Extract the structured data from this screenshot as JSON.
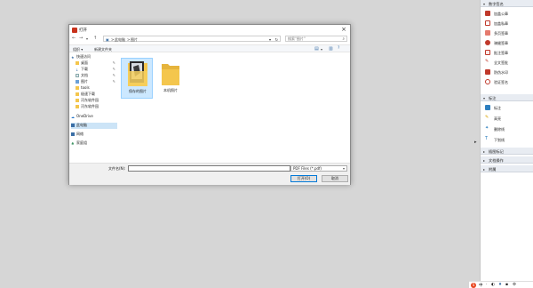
{
  "dialog": {
    "title": "打开",
    "nav": {
      "back": "←",
      "forward": "→",
      "up": "↑"
    },
    "address": {
      "crumbs": [
        "此电脑",
        "图片"
      ],
      "sep": ">"
    },
    "search": {
      "placeholder": "搜索\"图片\""
    },
    "toolbar": {
      "organize": "组织 ▾",
      "new_folder": "新建文件夹"
    },
    "nav_pane": [
      {
        "label": "快速访问",
        "icon": "star-icon",
        "pinned": false
      },
      {
        "label": "桌面",
        "icon": "desktop-icon",
        "pinned": true
      },
      {
        "label": "下载",
        "icon": "download-icon",
        "pinned": true
      },
      {
        "label": "文档",
        "icon": "document-icon",
        "pinned": true
      },
      {
        "label": "图片",
        "icon": "pictures-icon",
        "pinned": true
      },
      {
        "label": "tools",
        "icon": "folder-icon",
        "pinned": false
      },
      {
        "label": "极速下载",
        "icon": "folder-icon",
        "pinned": false
      },
      {
        "label": "河东软件园",
        "icon": "folder-icon",
        "pinned": false
      },
      {
        "label": "河东软件园",
        "icon": "folder-icon",
        "pinned": false
      },
      {
        "label": "OneDrive",
        "icon": "cloud-icon",
        "pinned": false
      },
      {
        "label": "此电脑",
        "icon": "computer-icon",
        "pinned": false,
        "selected": true
      },
      {
        "label": "网络",
        "icon": "network-icon",
        "pinned": false
      },
      {
        "label": "家庭组",
        "icon": "homegroup-icon",
        "pinned": false
      }
    ],
    "files": [
      {
        "label": "保存的图片",
        "selected": true
      },
      {
        "label": "本机照片",
        "selected": false
      }
    ],
    "filename_label": "文件名(N):",
    "filename_value": "",
    "filter": "PDF Files (*.pdf)",
    "open_button": "打开(O)",
    "cancel_button": "取消"
  },
  "rightpanel": {
    "sections": [
      {
        "title": "数字签名",
        "expanded": true,
        "tools": [
          {
            "label": "加盖公章",
            "icon": "stamp-icon",
            "color": "#c0392b"
          },
          {
            "label": "加盖私章",
            "icon": "seal-icon",
            "color": "#c0392b"
          },
          {
            "label": "多页签章",
            "icon": "multi-stamp-icon",
            "color": "#c0392b"
          },
          {
            "label": "骑缝签章",
            "icon": "seam-stamp-icon",
            "color": "#c0392b"
          },
          {
            "label": "批注签章",
            "icon": "annotation-stamp-icon",
            "color": "#c0392b"
          },
          {
            "label": "全文签批",
            "icon": "pen-sign-icon",
            "color": "#c0392b"
          },
          {
            "label": "防伪水印",
            "icon": "watermark-icon",
            "color": "#c0392b"
          },
          {
            "label": "验证签名",
            "icon": "verify-icon",
            "color": "#c0392b"
          }
        ]
      },
      {
        "title": "标注",
        "expanded": true,
        "tools": [
          {
            "label": "标注",
            "icon": "comment-icon",
            "color": "#2e7fbf"
          },
          {
            "label": "高亮",
            "icon": "highlight-icon",
            "color": "#d9a400"
          },
          {
            "label": "删除线",
            "icon": "strikethrough-icon",
            "color": "#2e7fbf"
          },
          {
            "label": "下划线",
            "icon": "underline-icon",
            "color": "#2e7fbf"
          }
        ]
      },
      {
        "title": "插图标记",
        "expanded": false,
        "tools": []
      },
      {
        "title": "文档操作",
        "expanded": false,
        "tools": []
      },
      {
        "title": "附属",
        "expanded": false,
        "tools": []
      }
    ]
  },
  "tray": {
    "ime": "中",
    "items": [
      "·",
      "◐",
      "♦",
      "▪",
      "⚙"
    ]
  },
  "colors": {
    "accent": "#0078d7",
    "selection": "#cce8ff",
    "folder": "#f4c64d"
  }
}
